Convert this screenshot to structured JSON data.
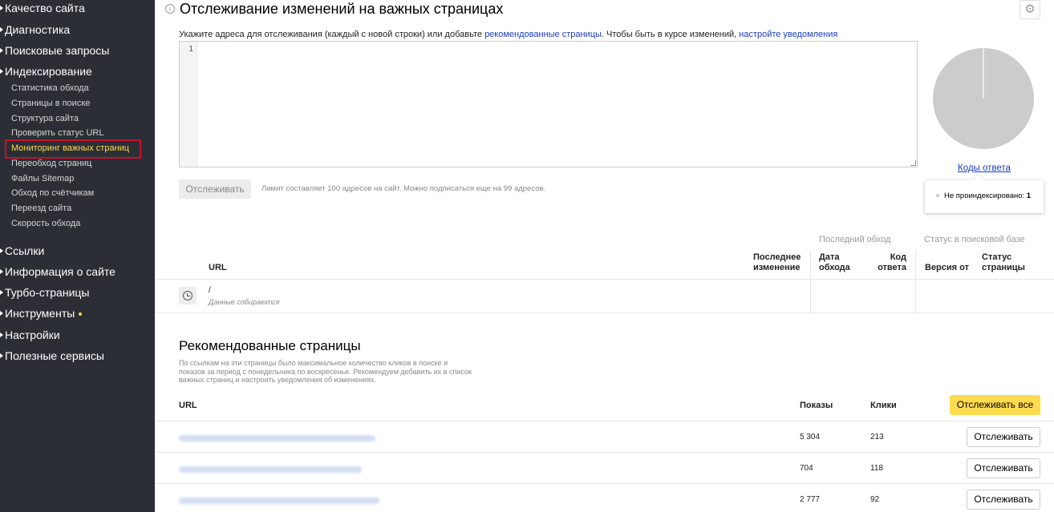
{
  "sidebar": {
    "top_items": [
      {
        "label": "Качество сайта"
      },
      {
        "label": "Диагностика"
      },
      {
        "label": "Поисковые запросы"
      },
      {
        "label": "Индексирование"
      }
    ],
    "sub_items": [
      {
        "label": "Статистика обхода"
      },
      {
        "label": "Страницы в поиске"
      },
      {
        "label": "Структура сайта"
      },
      {
        "label": "Проверить статус URL"
      },
      {
        "label": "Мониторинг важных страниц"
      },
      {
        "label": "Переобход страниц"
      },
      {
        "label": "Файлы Sitemap"
      },
      {
        "label": "Обход по счётчикам"
      },
      {
        "label": "Переезд сайта"
      },
      {
        "label": "Скорость обхода"
      }
    ],
    "bottom_items": [
      {
        "label": "Ссылки"
      },
      {
        "label": "Информация о сайте"
      },
      {
        "label": "Турбо-страницы"
      },
      {
        "label": "Инструменты"
      },
      {
        "label": "Настройки"
      },
      {
        "label": "Полезные сервисы"
      }
    ],
    "active_color": "#ffdb4d"
  },
  "main": {
    "title": "Отслеживание изменений на важных страницах",
    "hint_prefix": "Укажите адреса для отслеживания (каждый с новой строки) или добавьте ",
    "hint_link1": "рекомендованные страницы",
    "hint_middle": ". Чтобы быть в курсе изменений, ",
    "hint_link2": "настройте уведомления",
    "editor_line_number": "1",
    "track_button": "Отслеживать",
    "limit_text": "Лимит составляет 100 адресов на сайт. Можно подписаться еще на 99 адресов.",
    "codes_link": "Коды ответа",
    "legend": {
      "label": "Не проиндексировано:",
      "value": "1"
    }
  },
  "tracked_table": {
    "group_last_crawl": "Последний обход",
    "group_search_status": "Статус в поисковой базе",
    "columns": {
      "url": "URL",
      "last_change": [
        "Последнее",
        "изменение"
      ],
      "crawl_date": [
        "Дата",
        "обхода"
      ],
      "response_code": [
        "Код",
        "ответа"
      ],
      "version_from": "Версия от",
      "page_status": [
        "Статус",
        "страницы"
      ]
    },
    "rows": [
      {
        "url": "/",
        "status": "Данные собираются"
      }
    ]
  },
  "recommended": {
    "title": "Рекомендованные страницы",
    "description": "По ссылкам на эти страницы было максимальное количество кликов в поиске и показов за период с понедельника по воскресенье. Рекомендуем добавить их в список важных страниц и настроить уведомления об изменениях.",
    "columns": {
      "url": "URL",
      "shows": "Показы",
      "clicks": "Клики"
    },
    "track_all_button": "Отслеживать все",
    "rows": [
      {
        "shows": "5 304",
        "clicks": "213",
        "button": "Отслеживать"
      },
      {
        "shows": "704",
        "clicks": "118",
        "button": "Отслеживать"
      },
      {
        "shows": "2 777",
        "clicks": "92",
        "button": "Отслеживать"
      }
    ]
  },
  "pie_data": {
    "type": "pie",
    "slices": [
      {
        "name": "Не проиндексировано",
        "value": 1,
        "color": "#cccccc"
      }
    ]
  }
}
